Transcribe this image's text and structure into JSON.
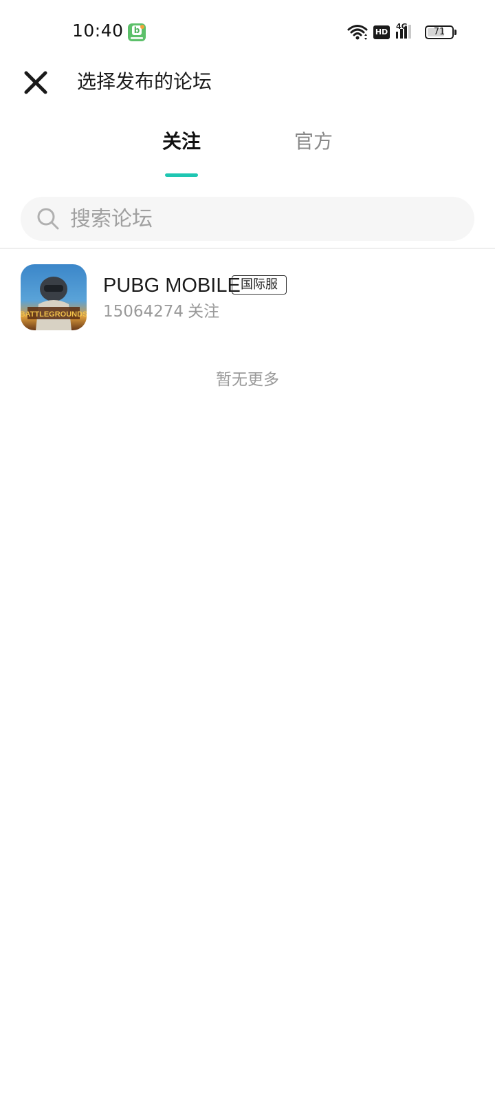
{
  "status_bar": {
    "time": "10:40",
    "notification_app_icon": "bilibili-style-green-app-icon",
    "wifi_icon": "wifi-icon",
    "hd_label": "HD",
    "network_label": "4G",
    "signal_icon": "signal-bars-icon",
    "battery_level": "71",
    "battery_fraction": 0.71
  },
  "header": {
    "close_icon": "close-icon",
    "title": "选择发布的论坛"
  },
  "tabs": [
    {
      "label": "关注",
      "active": true
    },
    {
      "label": "官方",
      "active": false
    }
  ],
  "accent_color": "#1fc6b2",
  "search": {
    "icon": "search-icon",
    "placeholder": "搜索论坛",
    "value": ""
  },
  "forums": [
    {
      "icon": "pubg-mobile-game-icon",
      "name": "PUBG MOBILE",
      "tag": "国际服",
      "followers": "15064274",
      "followers_suffix": "关注"
    }
  ],
  "list_footer": "暂无更多"
}
